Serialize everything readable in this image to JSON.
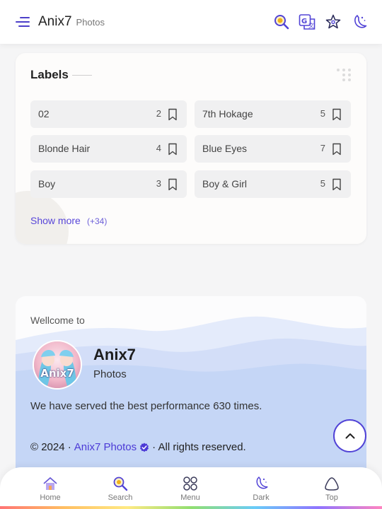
{
  "header": {
    "title": "Anix7",
    "subtitle": "Photos",
    "icons": [
      "menu-icon",
      "search-icon",
      "translate-icon",
      "star-icon",
      "dark-mode-icon"
    ]
  },
  "labels": {
    "title": "Labels",
    "items": [
      {
        "name": "02",
        "count": "2"
      },
      {
        "name": "7th Hokage",
        "count": "5"
      },
      {
        "name": "Blonde Hair",
        "count": "4"
      },
      {
        "name": "Blue Eyes",
        "count": "7"
      },
      {
        "name": "Boy",
        "count": "3"
      },
      {
        "name": "Boy & Girl",
        "count": "5"
      }
    ],
    "show_more": "Show more",
    "more_count": "(+34)"
  },
  "footer": {
    "welcome": "Wellcome to",
    "site_name": "Anix7",
    "site_sub": "Photos",
    "avatar_text": "Anix7",
    "served": "We have served the best performance 630 times.",
    "copyright_prefix": "© 2024 ·",
    "copyright_link": "Anix7 Photos",
    "copyright_suffix": "· All rights reserved."
  },
  "bottom_nav": {
    "items": [
      {
        "label": "Home",
        "icon": "home-icon"
      },
      {
        "label": "Search",
        "icon": "search-icon"
      },
      {
        "label": "Menu",
        "icon": "menu-grid-icon"
      },
      {
        "label": "Dark",
        "icon": "dark-mode-icon"
      },
      {
        "label": "Top",
        "icon": "top-icon"
      }
    ]
  },
  "colors": {
    "accent": "#5143d6",
    "search_icon": "#e7a614",
    "page_bg": "#f5f5f6",
    "wave": "#c5d6f6"
  }
}
